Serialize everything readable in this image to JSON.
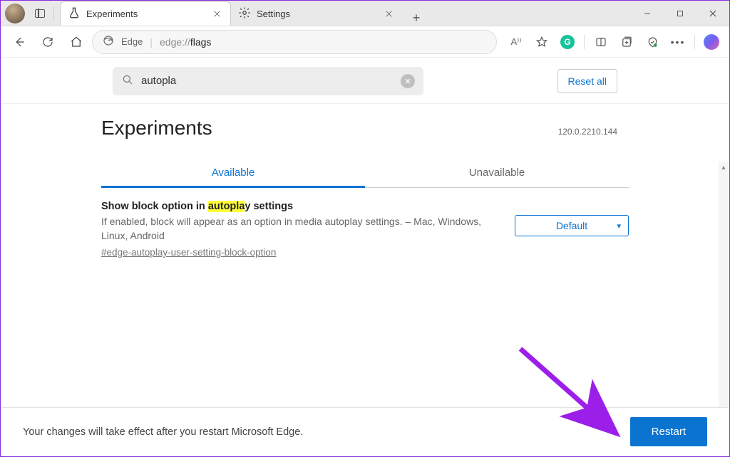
{
  "window": {
    "tabs": [
      {
        "icon": "flask",
        "label": "Experiments",
        "active": true
      },
      {
        "icon": "gear",
        "label": "Settings",
        "active": false
      }
    ]
  },
  "addressbar": {
    "engine_label": "Edge",
    "url_prefix": "edge://",
    "url_path": "flags"
  },
  "toolbar_icons": {
    "read_aloud": "A⁾⁾",
    "grammarly": "G"
  },
  "search": {
    "value": "autopla",
    "reset_label": "Reset all"
  },
  "header": {
    "title": "Experiments",
    "version": "120.0.2210.144"
  },
  "tabs": {
    "available": "Available",
    "unavailable": "Unavailable"
  },
  "flag": {
    "title_pre": "Show block option in ",
    "title_hl": "autopla",
    "title_post": "y settings",
    "description": "If enabled, block will appear as an option in media autoplay settings. – Mac, Windows, Linux, Android",
    "tag": "#edge-autoplay-user-setting-block-option",
    "select_value": "Default"
  },
  "footer": {
    "message": "Your changes will take effect after you restart Microsoft Edge.",
    "restart_label": "Restart"
  }
}
